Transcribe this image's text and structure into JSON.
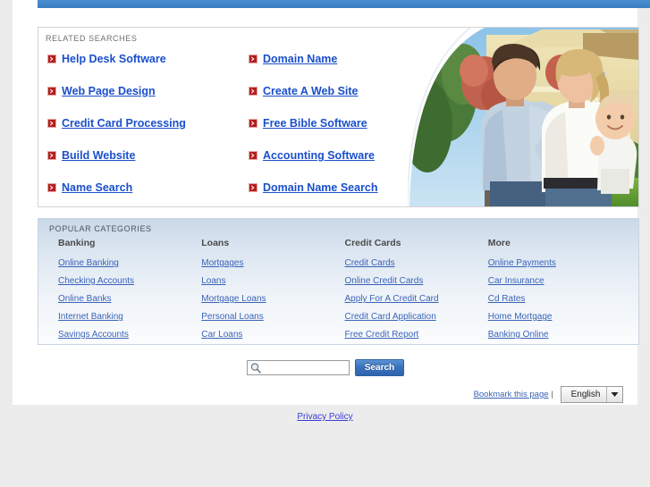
{
  "related": {
    "section_title": "RELATED SEARCHES",
    "bullet_icon": "red-arrow-bullet-icon",
    "links": [
      {
        "label": "Help Desk Software",
        "column": "left"
      },
      {
        "label": "Domain Name",
        "column": "right"
      },
      {
        "label": "Web Page Design",
        "column": "left"
      },
      {
        "label": "Create A Web Site",
        "column": "right"
      },
      {
        "label": "Credit Card Processing",
        "column": "left"
      },
      {
        "label": "Free Bible Software",
        "column": "right"
      },
      {
        "label": "Build Website",
        "column": "left"
      },
      {
        "label": "Accounting Software",
        "column": "right"
      },
      {
        "label": "Name Search",
        "column": "left"
      },
      {
        "label": "Domain Name Search",
        "column": "right"
      }
    ],
    "left_column": [
      "Help Desk Software",
      "Web Page Design",
      "Credit Card Processing",
      "Build Website",
      "Name Search"
    ],
    "right_column": [
      "Domain Name",
      "Create A Web Site",
      "Free Bible Software",
      "Accounting Software",
      "Domain Name Search"
    ],
    "photo": {
      "alt": "family-with-baby-in-front-of-house-photo",
      "description": "Man, woman and baby standing in front of a yellow two-story house"
    }
  },
  "categories": {
    "section_title": "POPULAR CATEGORIES",
    "columns": [
      {
        "heading": "Banking",
        "links": [
          "Online Banking",
          "Checking Accounts",
          "Online Banks",
          "Internet Banking",
          "Savings Accounts"
        ]
      },
      {
        "heading": "Loans",
        "links": [
          "Mortgages",
          "Loans",
          "Mortgage Loans",
          "Personal Loans",
          "Car Loans"
        ]
      },
      {
        "heading": "Credit Cards",
        "links": [
          "Credit Cards",
          "Online Credit Cards",
          "Apply For A Credit Card",
          "Credit Card Application",
          "Free Credit Report"
        ]
      },
      {
        "heading": "More",
        "links": [
          "Online Payments",
          "Car Insurance",
          "Cd Rates",
          "Home Mortgage",
          "Banking Online"
        ]
      }
    ]
  },
  "search": {
    "value": "",
    "placeholder": "",
    "icon": "magnifier-icon",
    "button_label": "Search"
  },
  "footer": {
    "bookmark_label": "Bookmark this page",
    "separator": "|",
    "language_selected": "English",
    "language_options": [
      "English"
    ],
    "privacy_label": "Privacy Policy"
  },
  "colors": {
    "top_bar": "#3f85ca",
    "link_blue": "#1a4fcc",
    "category_link_blue": "#3a63b8",
    "bullet_red": "#b31f1f",
    "page_background": "#ececec",
    "panel_background": "#ffffff",
    "search_button": "#3a72bd"
  }
}
